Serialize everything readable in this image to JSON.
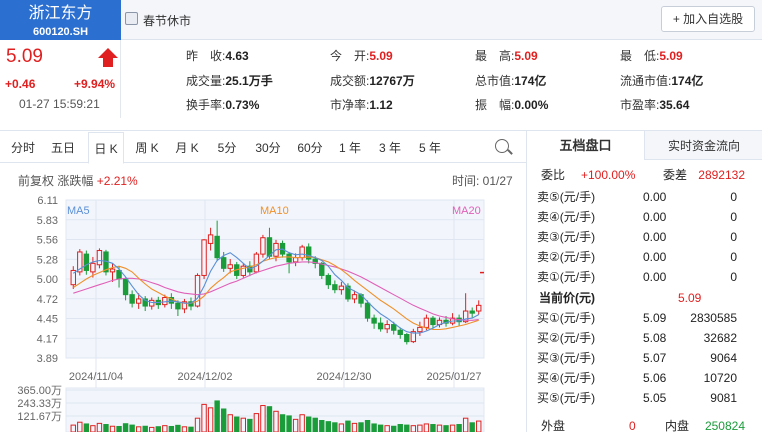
{
  "header": {
    "name": "浙江东方",
    "code": "600120.SH",
    "market_status": "春节休市",
    "add_label": "+ 加入自选股"
  },
  "quote": {
    "price": "5.09",
    "change": "+0.46",
    "change_pct": "+9.94%",
    "time": "01-27 15:59:21"
  },
  "stats": [
    {
      "label": "昨　收:",
      "value": "4.63"
    },
    {
      "label": "今　开:",
      "value": "5.09"
    },
    {
      "label": "最　高:",
      "value": "5.09"
    },
    {
      "label": "最　低:",
      "value": "5.09"
    },
    {
      "label": "成交量:",
      "value": "25.1万手"
    },
    {
      "label": "成交额:",
      "value": "12767万"
    },
    {
      "label": "总市值:",
      "value": "174亿"
    },
    {
      "label": "流通市值:",
      "value": "174亿"
    },
    {
      "label": "换手率:",
      "value": "0.73%"
    },
    {
      "label": "市净率:",
      "value": "1.12"
    },
    {
      "label": "振　幅:",
      "value": "0.00%"
    },
    {
      "label": "市盈率:",
      "value": "35.64"
    }
  ],
  "tabs": [
    "分时",
    "五日",
    "日 K",
    "周 K",
    "月 K",
    "5分",
    "30分",
    "60分",
    "1 年",
    "3 年",
    "5 年"
  ],
  "active_tab": "日 K",
  "kline": {
    "fq_label": "前复权 涨跌幅",
    "fq_value": "+2.21%",
    "time_label": "时间: 01/27"
  },
  "chart_data": {
    "type": "candlestick",
    "y_ticks": [
      "6.11",
      "5.83",
      "5.56",
      "5.28",
      "5.00",
      "4.72",
      "4.45",
      "4.17",
      "3.89"
    ],
    "ylim": [
      3.89,
      6.11
    ],
    "x_ticks": [
      "2024/11/04",
      "2024/12/02",
      "2024/12/30",
      "2025/01/27"
    ],
    "ma_labels": [
      "MA5",
      "MA10",
      "MA20"
    ],
    "colors": {
      "up": "#e02020",
      "down": "#1a9c3a",
      "ma5": "#5b8fd6",
      "ma10": "#f0902a",
      "ma20": "#e060b8"
    },
    "candles": [
      {
        "o": 4.92,
        "c": 5.12,
        "h": 5.18,
        "l": 4.86
      },
      {
        "o": 5.1,
        "c": 5.38,
        "h": 5.42,
        "l": 5.05
      },
      {
        "o": 5.35,
        "c": 5.12,
        "h": 5.4,
        "l": 5.06
      },
      {
        "o": 5.1,
        "c": 5.22,
        "h": 5.31,
        "l": 5.02
      },
      {
        "o": 5.2,
        "c": 5.4,
        "h": 5.43,
        "l": 5.15
      },
      {
        "o": 5.38,
        "c": 5.1,
        "h": 5.41,
        "l": 5.05
      },
      {
        "o": 5.1,
        "c": 5.14,
        "h": 5.22,
        "l": 4.96
      },
      {
        "o": 5.12,
        "c": 5.0,
        "h": 5.18,
        "l": 4.88
      },
      {
        "o": 5.0,
        "c": 4.78,
        "h": 5.02,
        "l": 4.7
      },
      {
        "o": 4.78,
        "c": 4.66,
        "h": 4.84,
        "l": 4.6
      },
      {
        "o": 4.66,
        "c": 4.72,
        "h": 4.8,
        "l": 4.58
      },
      {
        "o": 4.72,
        "c": 4.62,
        "h": 4.76,
        "l": 4.55
      },
      {
        "o": 4.62,
        "c": 4.7,
        "h": 4.74,
        "l": 4.57
      },
      {
        "o": 4.7,
        "c": 4.64,
        "h": 4.75,
        "l": 4.58
      },
      {
        "o": 4.64,
        "c": 4.74,
        "h": 4.78,
        "l": 4.6
      },
      {
        "o": 4.74,
        "c": 4.66,
        "h": 4.8,
        "l": 4.58
      },
      {
        "o": 4.66,
        "c": 4.58,
        "h": 4.7,
        "l": 4.48
      },
      {
        "o": 4.58,
        "c": 4.68,
        "h": 4.72,
        "l": 4.52
      },
      {
        "o": 4.68,
        "c": 4.62,
        "h": 4.74,
        "l": 4.56
      },
      {
        "o": 4.62,
        "c": 5.05,
        "h": 5.08,
        "l": 4.6
      },
      {
        "o": 5.05,
        "c": 5.55,
        "h": 5.56,
        "l": 5.0
      },
      {
        "o": 5.5,
        "c": 5.62,
        "h": 5.72,
        "l": 5.4
      },
      {
        "o": 5.6,
        "c": 5.3,
        "h": 5.82,
        "l": 5.25
      },
      {
        "o": 5.3,
        "c": 5.15,
        "h": 5.38,
        "l": 5.1
      },
      {
        "o": 5.15,
        "c": 5.2,
        "h": 5.28,
        "l": 5.08
      },
      {
        "o": 5.2,
        "c": 5.05,
        "h": 5.24,
        "l": 5.0
      },
      {
        "o": 5.05,
        "c": 5.18,
        "h": 5.22,
        "l": 5.02
      },
      {
        "o": 5.18,
        "c": 5.1,
        "h": 5.25,
        "l": 5.04
      },
      {
        "o": 5.1,
        "c": 5.35,
        "h": 5.38,
        "l": 5.08
      },
      {
        "o": 5.35,
        "c": 5.58,
        "h": 5.62,
        "l": 5.3
      },
      {
        "o": 5.58,
        "c": 5.32,
        "h": 5.72,
        "l": 5.28
      },
      {
        "o": 5.32,
        "c": 5.5,
        "h": 5.55,
        "l": 5.25
      },
      {
        "o": 5.5,
        "c": 5.35,
        "h": 5.54,
        "l": 5.3
      },
      {
        "o": 5.35,
        "c": 5.24,
        "h": 5.38,
        "l": 5.08
      },
      {
        "o": 5.24,
        "c": 5.3,
        "h": 5.36,
        "l": 5.18
      },
      {
        "o": 5.3,
        "c": 5.45,
        "h": 5.48,
        "l": 5.26
      },
      {
        "o": 5.45,
        "c": 5.28,
        "h": 5.5,
        "l": 5.22
      },
      {
        "o": 5.28,
        "c": 5.22,
        "h": 5.32,
        "l": 5.15
      },
      {
        "o": 5.22,
        "c": 5.05,
        "h": 5.24,
        "l": 5.0
      },
      {
        "o": 5.05,
        "c": 4.92,
        "h": 5.08,
        "l": 4.86
      },
      {
        "o": 4.92,
        "c": 4.85,
        "h": 4.98,
        "l": 4.8
      },
      {
        "o": 4.85,
        "c": 4.9,
        "h": 4.96,
        "l": 4.78
      },
      {
        "o": 4.9,
        "c": 4.72,
        "h": 4.94,
        "l": 4.68
      },
      {
        "o": 4.72,
        "c": 4.78,
        "h": 4.84,
        "l": 4.66
      },
      {
        "o": 4.78,
        "c": 4.66,
        "h": 4.8,
        "l": 4.6
      },
      {
        "o": 4.66,
        "c": 4.45,
        "h": 4.7,
        "l": 4.4
      },
      {
        "o": 4.45,
        "c": 4.38,
        "h": 4.5,
        "l": 4.3
      },
      {
        "o": 4.38,
        "c": 4.3,
        "h": 4.46,
        "l": 4.26
      },
      {
        "o": 4.3,
        "c": 4.36,
        "h": 4.42,
        "l": 4.24
      },
      {
        "o": 4.36,
        "c": 4.28,
        "h": 4.4,
        "l": 4.22
      },
      {
        "o": 4.28,
        "c": 4.22,
        "h": 4.32,
        "l": 4.16
      },
      {
        "o": 4.22,
        "c": 4.12,
        "h": 4.24,
        "l": 4.08
      },
      {
        "o": 4.12,
        "c": 4.26,
        "h": 4.3,
        "l": 4.1
      },
      {
        "o": 4.26,
        "c": 4.32,
        "h": 4.4,
        "l": 4.2
      },
      {
        "o": 4.32,
        "c": 4.45,
        "h": 4.5,
        "l": 4.28
      },
      {
        "o": 4.45,
        "c": 4.36,
        "h": 4.48,
        "l": 4.3
      },
      {
        "o": 4.36,
        "c": 4.42,
        "h": 4.46,
        "l": 4.32
      },
      {
        "o": 4.42,
        "c": 4.38,
        "h": 4.48,
        "l": 4.33
      },
      {
        "o": 4.38,
        "c": 4.45,
        "h": 4.52,
        "l": 4.35
      },
      {
        "o": 4.45,
        "c": 4.4,
        "h": 4.5,
        "l": 4.34
      },
      {
        "o": 4.4,
        "c": 4.55,
        "h": 4.8,
        "l": 4.38
      },
      {
        "o": 4.55,
        "c": 4.52,
        "h": 4.6,
        "l": 4.46
      },
      {
        "o": 4.55,
        "c": 4.63,
        "h": 4.7,
        "l": 4.5
      }
    ],
    "last_close": {
      "price": 5.09,
      "color": "#e02020"
    },
    "ma5": [
      5.08,
      5.14,
      5.2,
      5.24,
      5.26,
      5.25,
      5.22,
      5.14,
      5.03,
      4.9,
      4.78,
      4.7,
      4.67,
      4.67,
      4.68,
      4.69,
      4.68,
      4.66,
      4.66,
      4.73,
      4.9,
      5.11,
      5.26,
      5.33,
      5.37,
      5.3,
      5.22,
      5.14,
      5.18,
      5.25,
      5.33,
      5.41,
      5.42,
      5.37,
      5.34,
      5.35,
      5.33,
      5.3,
      5.26,
      5.18,
      5.06,
      4.98,
      4.88,
      4.83,
      4.78,
      4.68,
      4.59,
      4.51,
      4.45,
      4.38,
      4.31,
      4.26,
      4.24,
      4.24,
      4.27,
      4.31,
      4.36,
      4.39,
      4.41,
      4.41,
      4.44,
      4.45,
      4.5
    ],
    "ma10": [
      4.88,
      4.94,
      5.0,
      5.05,
      5.09,
      5.13,
      5.16,
      5.18,
      5.15,
      5.1,
      5.01,
      4.93,
      4.86,
      4.81,
      4.76,
      4.72,
      4.68,
      4.66,
      4.66,
      4.69,
      4.76,
      4.87,
      4.95,
      5.02,
      5.1,
      5.13,
      5.15,
      5.17,
      5.2,
      5.25,
      5.28,
      5.3,
      5.31,
      5.31,
      5.3,
      5.3,
      5.31,
      5.3,
      5.27,
      5.24,
      5.19,
      5.13,
      5.06,
      4.98,
      4.91,
      4.84,
      4.77,
      4.7,
      4.64,
      4.58,
      4.51,
      4.44,
      4.38,
      4.34,
      4.31,
      4.29,
      4.29,
      4.3,
      4.32,
      4.34,
      4.36,
      4.39,
      4.42
    ],
    "ma20": [
      4.8,
      4.83,
      4.86,
      4.89,
      4.92,
      4.95,
      4.98,
      5.0,
      5.01,
      5.01,
      5.0,
      4.98,
      4.95,
      4.92,
      4.88,
      4.85,
      4.82,
      4.8,
      4.79,
      4.78,
      4.79,
      4.82,
      4.86,
      4.9,
      4.94,
      4.97,
      5.01,
      5.05,
      5.09,
      5.12,
      5.15,
      5.18,
      5.2,
      5.22,
      5.23,
      5.24,
      5.24,
      5.23,
      5.21,
      5.19,
      5.17,
      5.14,
      5.11,
      5.07,
      5.03,
      4.98,
      4.93,
      4.88,
      4.83,
      4.78,
      4.73,
      4.68,
      4.63,
      4.59,
      4.55,
      4.51,
      4.48,
      4.46,
      4.44,
      4.43,
      4.42,
      4.42,
      4.43
    ],
    "volume": {
      "y_ticks": [
        "365.00万",
        "243.33万",
        "121.67万"
      ],
      "ylim": [
        0,
        365
      ],
      "values": [
        60,
        85,
        70,
        55,
        75,
        65,
        50,
        48,
        72,
        60,
        45,
        50,
        40,
        46,
        55,
        48,
        58,
        45,
        42,
        120,
        240,
        210,
        270,
        200,
        150,
        130,
        120,
        110,
        160,
        230,
        220,
        180,
        150,
        140,
        110,
        150,
        130,
        120,
        100,
        90,
        80,
        70,
        95,
        75,
        80,
        100,
        70,
        60,
        55,
        50,
        65,
        60,
        55,
        60,
        70,
        65,
        60,
        55,
        60,
        65,
        120,
        80,
        95
      ]
    }
  },
  "orderbook": {
    "tab1": "五档盘口",
    "tab2": "实时资金流向",
    "wb_label": "委比",
    "wb_value": "+100.00%",
    "wc_label": "委差",
    "wc_value": "2892132",
    "asks": [
      {
        "label": "卖⑤(元/手)",
        "price": "0.00",
        "vol": "0"
      },
      {
        "label": "卖④(元/手)",
        "price": "0.00",
        "vol": "0"
      },
      {
        "label": "卖③(元/手)",
        "price": "0.00",
        "vol": "0"
      },
      {
        "label": "卖②(元/手)",
        "price": "0.00",
        "vol": "0"
      },
      {
        "label": "卖①(元/手)",
        "price": "0.00",
        "vol": "0"
      }
    ],
    "cur_label": "当前价(元)",
    "cur_price": "5.09",
    "bids": [
      {
        "label": "买①(元/手)",
        "price": "5.09",
        "vol": "2830585"
      },
      {
        "label": "买②(元/手)",
        "price": "5.08",
        "vol": "32682"
      },
      {
        "label": "买③(元/手)",
        "price": "5.07",
        "vol": "9064"
      },
      {
        "label": "买④(元/手)",
        "price": "5.06",
        "vol": "10720"
      },
      {
        "label": "买⑤(元/手)",
        "price": "5.05",
        "vol": "9081"
      }
    ],
    "outer_label": "外盘",
    "outer_value": "0",
    "inner_label": "内盘",
    "inner_value": "250824"
  }
}
